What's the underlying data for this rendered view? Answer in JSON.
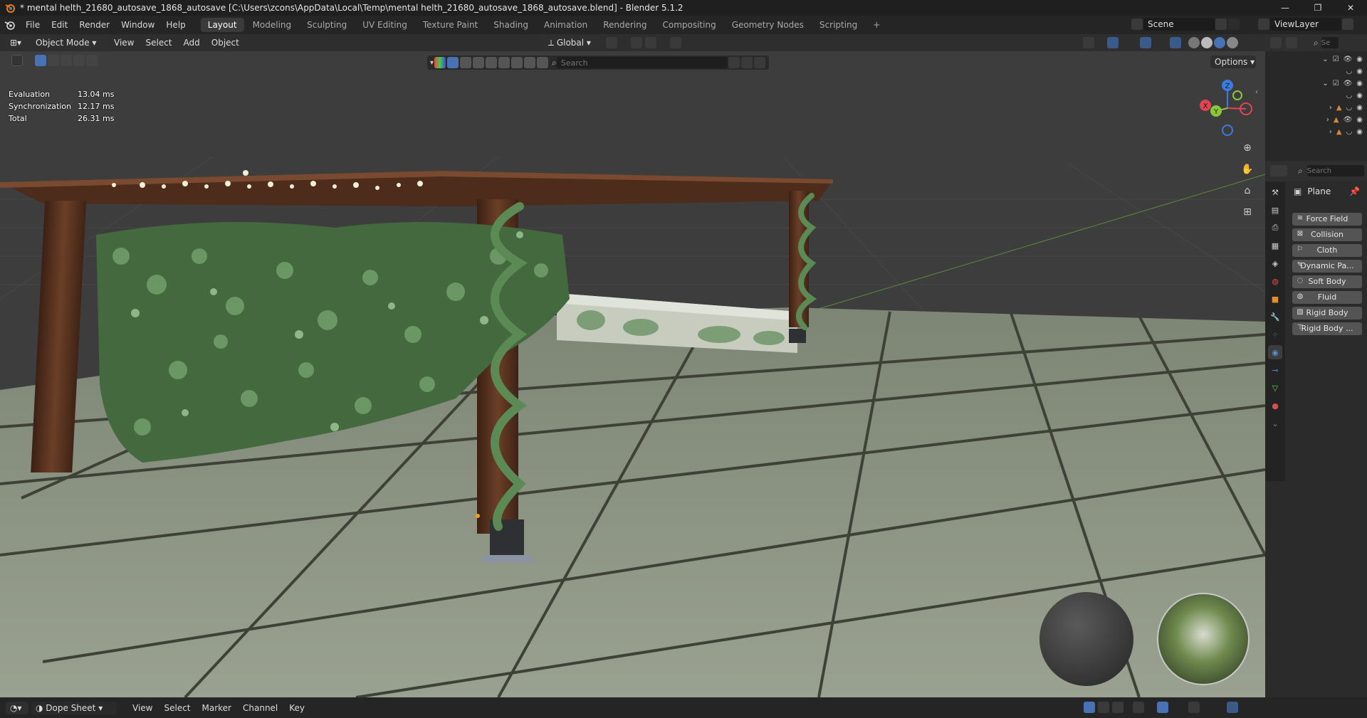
{
  "window": {
    "title": "* mental helth_21680_autosave_1868_autosave [C:\\Users\\zcons\\AppData\\Local\\Temp\\mental helth_21680_autosave_1868_autosave.blend] - Blender 5.1.2",
    "controls": [
      "—",
      "❐",
      "✕"
    ]
  },
  "menu": [
    "File",
    "Edit",
    "Render",
    "Window",
    "Help"
  ],
  "workspaces": [
    {
      "label": "Layout",
      "active": true
    },
    {
      "label": "Modeling"
    },
    {
      "label": "Sculpting"
    },
    {
      "label": "UV Editing"
    },
    {
      "label": "Texture Paint"
    },
    {
      "label": "Shading"
    },
    {
      "label": "Animation"
    },
    {
      "label": "Rendering"
    },
    {
      "label": "Compositing"
    },
    {
      "label": "Geometry Nodes"
    },
    {
      "label": "Scripting"
    }
  ],
  "add_workspace": "+",
  "scene": {
    "label": "Scene",
    "view_layer": "ViewLayer"
  },
  "viewport_header": {
    "mode": "Object Mode",
    "menus": [
      "View",
      "Select",
      "Add",
      "Object"
    ],
    "transform_orientation": "Global",
    "search_placeholder": "Search",
    "options": "Options"
  },
  "stats": [
    {
      "label": "Evaluation",
      "value": "13.04 ms"
    },
    {
      "label": "Synchronization",
      "value": "12.17 ms"
    },
    {
      "label": "Total",
      "value": "26.31 ms"
    }
  ],
  "gizmo": {
    "x": "X",
    "y": "Y",
    "z": "Z"
  },
  "properties": {
    "search_placeholder": "Search",
    "object_name": "Plane",
    "physics_buttons": [
      "Force Field",
      "Collision",
      "Cloth",
      "Dynamic Pa...",
      "Soft Body",
      "Fluid",
      "Rigid Body",
      "Rigid Body ..."
    ]
  },
  "outliner": {
    "search_placeholder": "Se"
  },
  "bottom": {
    "editor": "Dope Sheet",
    "menus": [
      "View",
      "Select",
      "Marker",
      "Channel",
      "Key"
    ]
  },
  "colors": {
    "accent": "#4772b3",
    "axis_x": "#e04553",
    "axis_y": "#8bc63a",
    "axis_z": "#3b7be0",
    "ivy": "#4f7a47",
    "wood": "#5a3420",
    "stone": "#8d9482"
  }
}
